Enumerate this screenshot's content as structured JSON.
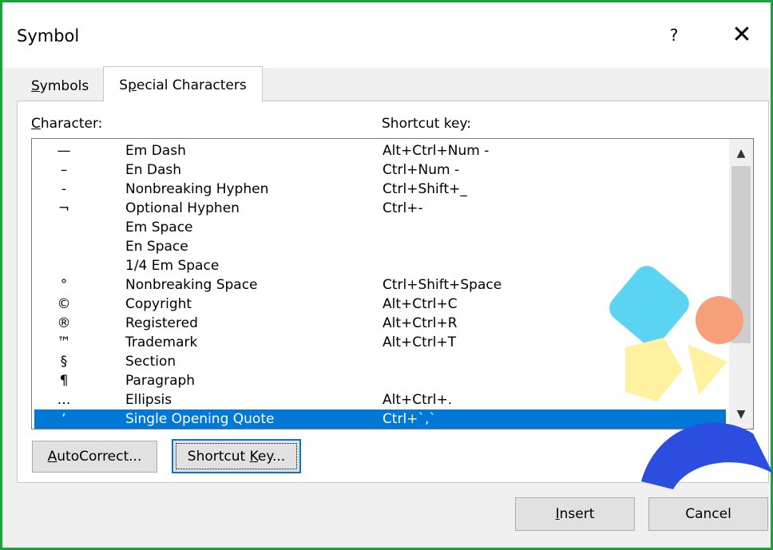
{
  "dialog": {
    "title": "Symbol",
    "help_label": "?",
    "close_label": "✕"
  },
  "tabs": [
    {
      "label": "Symbols",
      "underline_char": "S",
      "rest": "ymbols",
      "active": false
    },
    {
      "label": "Special Characters",
      "prefix": "S",
      "underline_char": "p",
      "rest": "ecial Characters",
      "active": true
    }
  ],
  "columns": {
    "character_underline": "C",
    "character_rest": "haracter:",
    "shortcut_key": "Shortcut key:"
  },
  "rows": [
    {
      "symbol": "—",
      "name": "Em Dash",
      "shortcut": "Alt+Ctrl+Num -"
    },
    {
      "symbol": "–",
      "name": "En Dash",
      "shortcut": "Ctrl+Num -"
    },
    {
      "symbol": "-",
      "name": "Nonbreaking Hyphen",
      "shortcut": "Ctrl+Shift+_"
    },
    {
      "symbol": "¬",
      "name": "Optional Hyphen",
      "shortcut": "Ctrl+-"
    },
    {
      "symbol": "",
      "name": "Em Space",
      "shortcut": ""
    },
    {
      "symbol": "",
      "name": "En Space",
      "shortcut": ""
    },
    {
      "symbol": "",
      "name": "1/4 Em Space",
      "shortcut": ""
    },
    {
      "symbol": "°",
      "name": "Nonbreaking Space",
      "shortcut": "Ctrl+Shift+Space"
    },
    {
      "symbol": "©",
      "name": "Copyright",
      "shortcut": "Alt+Ctrl+C"
    },
    {
      "symbol": "®",
      "name": "Registered",
      "shortcut": "Alt+Ctrl+R"
    },
    {
      "symbol": "™",
      "name": "Trademark",
      "shortcut": "Alt+Ctrl+T"
    },
    {
      "symbol": "§",
      "name": "Section",
      "shortcut": ""
    },
    {
      "symbol": "¶",
      "name": "Paragraph",
      "shortcut": ""
    },
    {
      "symbol": "…",
      "name": "Ellipsis",
      "shortcut": "Alt+Ctrl+."
    },
    {
      "symbol": "‘",
      "name": "Single Opening Quote",
      "shortcut": "Ctrl+`,`",
      "selected": true
    }
  ],
  "scrollbar": {
    "up_icon": "▲",
    "down_icon": "▼"
  },
  "buttons": {
    "autocorrect_underline": "A",
    "autocorrect_rest": "utoCorrect...",
    "shortcut_prefix": "Shortcut ",
    "shortcut_underline": "K",
    "shortcut_rest": "ey...",
    "insert_underline": "I",
    "insert_rest": "nsert",
    "cancel": "Cancel"
  },
  "colors": {
    "frame_border": "#1aa33c",
    "selection": "#0078d7",
    "watermark_cyan": "#5ad4f0",
    "watermark_salmon": "#f5a07a",
    "watermark_yellow": "#fff1a0",
    "watermark_blue": "#2b4de0"
  }
}
